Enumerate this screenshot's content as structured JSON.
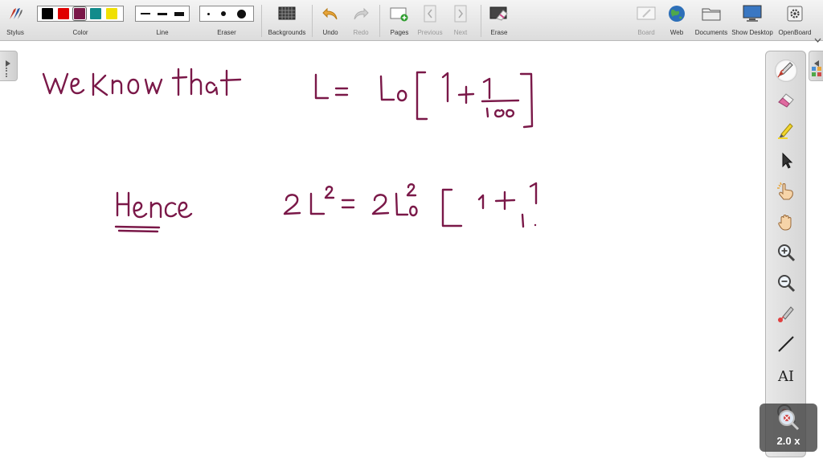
{
  "toolbar": {
    "stylus_label": "Stylus",
    "color_label": "Color",
    "line_label": "Line",
    "eraser_label": "Eraser",
    "backgrounds_label": "Backgrounds",
    "undo_label": "Undo",
    "redo_label": "Redo",
    "pages_label": "Pages",
    "previous_label": "Previous",
    "next_label": "Next",
    "erase_label": "Erase",
    "board_label": "Board",
    "web_label": "Web",
    "documents_label": "Documents",
    "show_desktop_label": "Show Desktop",
    "openboard_label": "OpenBoard"
  },
  "colors": {
    "palette": [
      "#000000",
      "#e00000",
      "#7a1848",
      "#118b8b",
      "#f0e000"
    ],
    "selected_index": 2,
    "ink": "#7a1848"
  },
  "vertical_tools": [
    {
      "name": "pen-icon",
      "selected": true
    },
    {
      "name": "eraser-icon",
      "selected": false
    },
    {
      "name": "marker-icon",
      "selected": false
    },
    {
      "name": "selector-icon",
      "selected": false
    },
    {
      "name": "interact-hand-icon",
      "selected": false
    },
    {
      "name": "pan-hand-icon",
      "selected": false
    },
    {
      "name": "zoom-in-icon",
      "selected": false
    },
    {
      "name": "zoom-out-icon",
      "selected": false
    },
    {
      "name": "laser-pointer-icon",
      "selected": false
    },
    {
      "name": "line-icon",
      "selected": false
    },
    {
      "name": "text-icon",
      "selected": false
    },
    {
      "name": "magnifier-icon",
      "selected": false
    }
  ],
  "text_tool_glyph": "AI",
  "zoom": {
    "value": 2.0,
    "label": "2.0 x"
  }
}
